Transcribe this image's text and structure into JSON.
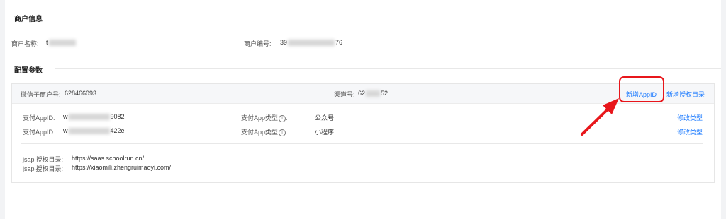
{
  "merchant_section": {
    "title": "商户信息",
    "name_label": "商户名称:",
    "name_value_prefix": "t",
    "number_label": "商户编号:",
    "number_prefix": "39",
    "number_suffix": "76"
  },
  "config_section": {
    "title": "配置参数",
    "wechat_sub_label": "微信子商户号:",
    "wechat_sub_value": "628466093",
    "channel_label": "渠道号:",
    "channel_prefix": "62",
    "channel_suffix": "52",
    "add_appid_label": "新增AppID",
    "add_auth_dir_label": "新增授权目录",
    "appids": [
      {
        "label": "支付AppID:",
        "prefix": "w",
        "suffix": "9082",
        "type_label": "支付App类型",
        "type_value": "公众号",
        "action_label": "修改类型"
      },
      {
        "label": "支付AppID:",
        "prefix": "w",
        "suffix": "422e",
        "type_label": "支付App类型",
        "type_value": "小程序",
        "action_label": "修改类型"
      }
    ],
    "jsapi": [
      {
        "label": "jsapi授权目录:",
        "value": "https://saas.schoolrun.cn/"
      },
      {
        "label": "jsapi授权目录:",
        "value": "https://xiaomili.zhengruimaoyi.com/"
      }
    ]
  },
  "colors": {
    "link": "#1677ff",
    "highlight": "#e8161b"
  }
}
